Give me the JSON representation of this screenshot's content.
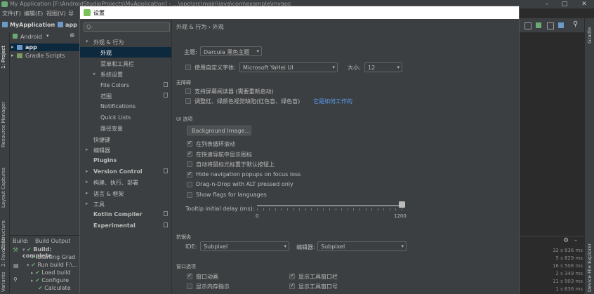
{
  "ide": {
    "title": "My Application [F:\\AndroidStudioProjects\\MyApplication] - ...\\app\\src\\main\\java\\com\\example\\myapplication\\MainActivity.java [app] - Android Studio",
    "menu": [
      "文件(F)",
      "编辑(E)",
      "视图(V)",
      "导"
    ],
    "nav_project": "MyApplication",
    "nav_module": "app",
    "project_view": "Android",
    "tree": [
      "app",
      "Gradle Scripts"
    ],
    "left_tabs": [
      "1: Project",
      "Resource Manager",
      "Layout Captures",
      "Z: Structure",
      "2: Favorites",
      "Variants"
    ],
    "right_tabs": [
      "Gradle",
      "Device File Explorer"
    ],
    "build_tabs": [
      "Build:",
      "Build Output"
    ],
    "build_lines": [
      "Build: complete",
      "Starting Grad",
      "Run build F:\\...",
      "Load build",
      "Configure",
      "Calculate"
    ],
    "log_times": [
      "32 s 836 ms",
      "5 s 629 ms",
      "16 s 508 ms",
      "2 s 349 ms",
      "11 s 903 ms",
      "1 s 636 ms"
    ]
  },
  "dialog": {
    "title": "设置",
    "search_placeholder": "Q-",
    "breadcrumb": "外观 & 行为  ›  外观",
    "nav": [
      {
        "label": "外观 & 行为",
        "expanded": true
      },
      {
        "label": "外观",
        "selected": true
      },
      {
        "label": "菜单和工具栏"
      },
      {
        "label": "系统设置",
        "collapsed": true
      },
      {
        "label": "File Colors",
        "proj": true
      },
      {
        "label": "范围",
        "proj": true
      },
      {
        "label": "Notifications"
      },
      {
        "label": "Quick Lists"
      },
      {
        "label": "路径变量"
      },
      {
        "label": "快捷键"
      },
      {
        "label": "编辑器",
        "collapsed": true
      },
      {
        "label": "Plugins",
        "bold": true
      },
      {
        "label": "Version Control",
        "bold": true,
        "collapsed": true,
        "proj": true
      },
      {
        "label": "构建、执行、部署",
        "collapsed": true
      },
      {
        "label": "语言 & 框架",
        "collapsed": true
      },
      {
        "label": "工具",
        "collapsed": true
      },
      {
        "label": "Kotlin Compiler",
        "bold": true,
        "proj": true
      },
      {
        "label": "Experimental",
        "bold": true,
        "proj": true
      }
    ],
    "theme": {
      "label": "主题:",
      "value": "Darcula 黑色主题"
    },
    "custom_font": {
      "label": "使用自定义字体:",
      "checked": false,
      "font": "Microsoft YaHei UI",
      "size_label": "大小:",
      "size": "12"
    },
    "accessibility": {
      "header": "无障碍",
      "screen_reader": {
        "label": "支持屏幕阅读器 (需要重新启动)",
        "checked": false
      },
      "color_blind": {
        "label": "调整红、绿颜色视觉缺陷(红色盲、绿色盲)",
        "link": "它是如何工作的",
        "checked": false
      }
    },
    "ui_options": {
      "header": "UI 选项",
      "bg_button": "Background Image...",
      "checks": [
        {
          "label": "在列表循环滚动",
          "checked": true
        },
        {
          "label": "在快速导航中显示图标",
          "checked": true
        },
        {
          "label": "自动将鼠标光标置于默认按钮上",
          "checked": false
        },
        {
          "label": "Hide navigation popups on focus loss",
          "checked": true
        },
        {
          "label": "Drag-n-Drop with ALT pressed only",
          "checked": false
        },
        {
          "label": "Show flags for languages",
          "checked": false
        }
      ],
      "tooltip_label": "Tooltip initial delay (ms):",
      "tooltip_min": "0",
      "tooltip_max": "1200",
      "tooltip_value": 1200
    },
    "antialias": {
      "header": "抗锯齿",
      "ide_label": "IDE:",
      "ide_value": "Subpixel",
      "editor_label": "编辑器:",
      "editor_value": "Subpixel"
    },
    "window_options": {
      "header": "窗口选项",
      "left": [
        {
          "label": "窗口动画",
          "checked": true
        },
        {
          "label": "显示内存指示",
          "checked": false
        }
      ],
      "right": [
        {
          "label": "显示工具窗口栏",
          "checked": true
        },
        {
          "label": "显示工具窗口号",
          "checked": true
        }
      ]
    }
  }
}
